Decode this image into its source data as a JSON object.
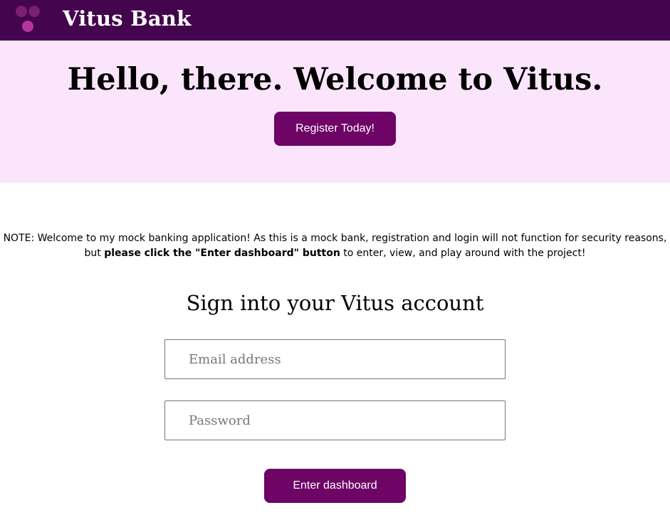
{
  "header": {
    "brand": "Vitus Bank",
    "logo_icon": "grape-cluster-icon",
    "background_color": "#44044e"
  },
  "hero": {
    "title": "Hello, there. Welcome to Vitus.",
    "register_label": "Register Today!",
    "background_color": "#fbe5fd"
  },
  "note": {
    "line1": "NOTE: Welcome to my mock banking application! As this is a mock bank, registration and login will not function for security reasons,",
    "line2_prefix": "but ",
    "line2_bold": "please click the \"Enter dashboard\" button",
    "line2_suffix": " to enter, view, and play around with the project!"
  },
  "signin": {
    "title": "Sign into your Vitus account",
    "email_placeholder": "Email address",
    "email_value": "",
    "password_placeholder": "Password",
    "password_value": "",
    "enter_label": "Enter dashboard"
  },
  "colors": {
    "button": "#6d0466",
    "button_text": "#ffffff"
  }
}
